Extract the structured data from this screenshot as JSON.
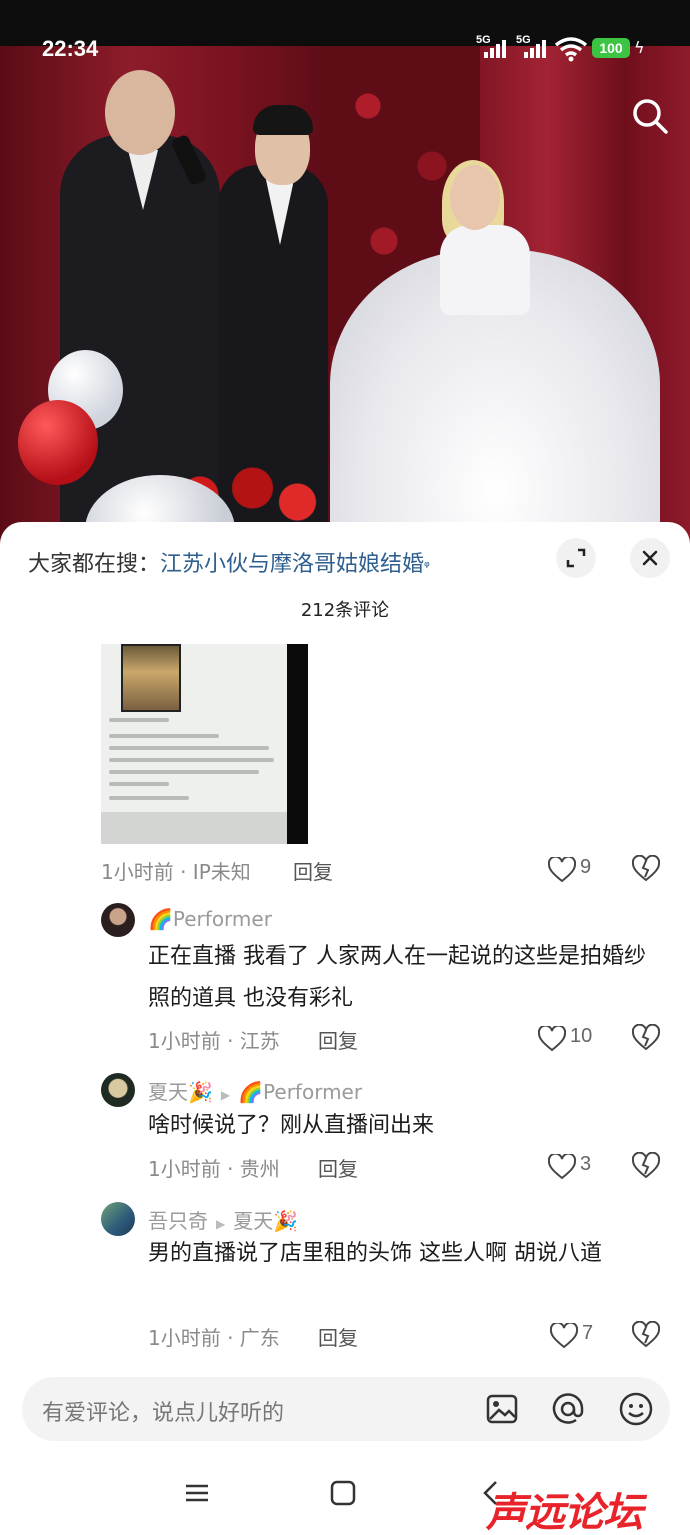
{
  "status_bar": {
    "time": "22:34",
    "signal1": "5G",
    "signal2": "5G",
    "battery": "100"
  },
  "sheet": {
    "hot_search_prefix": "大家都在搜：",
    "hot_search_query": "江苏小伙与摩洛哥姑娘结婚",
    "comment_count": "212条评论"
  },
  "comments": [
    {
      "type": "image",
      "time": "1小时前 · IP未知",
      "reply": "回复",
      "likes": "9"
    },
    {
      "user": "Performer",
      "text": "正在直播 我看了 人家两人在一起说的这些是拍婚纱照的道具 也没有彩礼",
      "time": "1小时前 · 江苏",
      "reply": "回复",
      "likes": "10"
    },
    {
      "user": "夏天",
      "reply_to": "Performer",
      "text": "啥时候说了？刚从直播间出来",
      "time": "1小时前 · 贵州",
      "reply": "回复",
      "likes": "3"
    },
    {
      "user": "吾只奇",
      "reply_to": "夏天",
      "text": "男的直播说了店里租的头饰  这些人啊 胡说八道",
      "time": "1小时前 · 广东",
      "reply": "回复",
      "likes": "7"
    }
  ],
  "input": {
    "placeholder": "有爱评论，说点儿好听的"
  },
  "watermark": "声远论坛",
  "icons": [
    "search-icon",
    "expand-icon",
    "close-icon",
    "heart-icon",
    "broken-heart-icon",
    "image-icon",
    "at-icon",
    "emoji-icon",
    "menu-icon",
    "home-square-icon",
    "back-icon"
  ],
  "colors": {
    "link": "#2f5f8e",
    "battery": "#3cc442",
    "watermark": "#e8232a"
  }
}
